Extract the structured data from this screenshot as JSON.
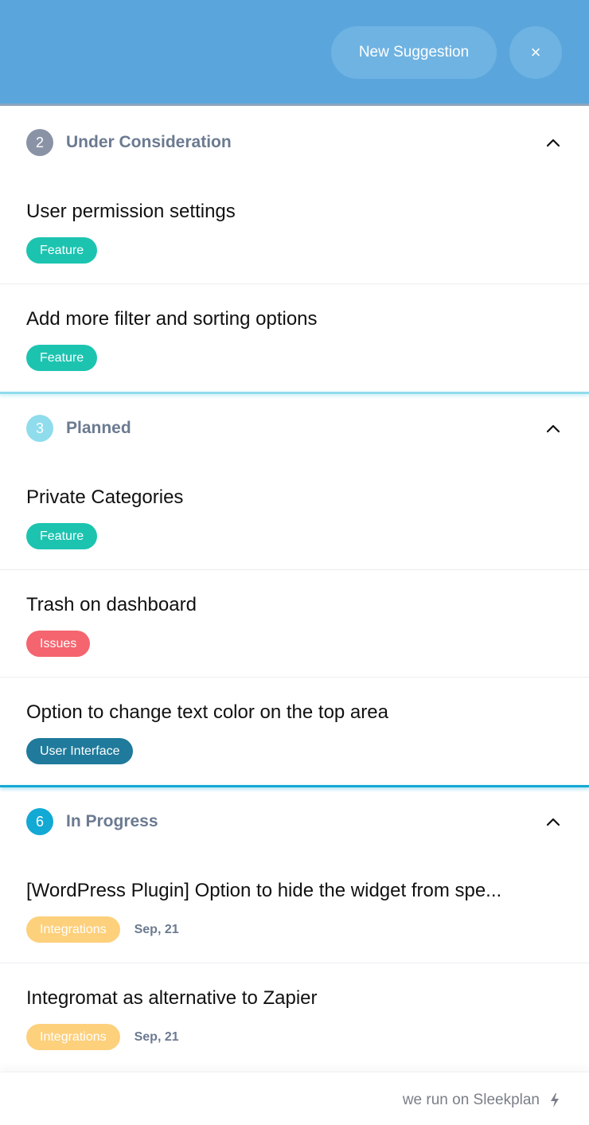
{
  "header": {
    "new_suggestion_label": "New Suggestion",
    "close_label": "×"
  },
  "sections": [
    {
      "count": "2",
      "title": "Under Consideration",
      "badge_color": "#8a93a6",
      "items": [
        {
          "title": "User permission settings",
          "tag": "Feature"
        },
        {
          "title": "Add more filter and sorting options",
          "tag": "Feature"
        }
      ]
    },
    {
      "count": "3",
      "title": "Planned",
      "badge_color": "#8fdcec",
      "items": [
        {
          "title": "Private Categories",
          "tag": "Feature"
        },
        {
          "title": "Trash on dashboard",
          "tag": "Issues"
        },
        {
          "title": "Option to change text color on the top area",
          "tag": "User Interface"
        }
      ]
    },
    {
      "count": "6",
      "title": "In Progress",
      "badge_color": "#12a9d4",
      "items": [
        {
          "title": "[WordPress Plugin] Option to hide the widget from spe...",
          "tag": "Integrations",
          "date": "Sep, 21"
        },
        {
          "title": "Integromat as alternative to Zapier",
          "tag": "Integrations",
          "date": "Sep, 21"
        }
      ]
    }
  ],
  "footer": {
    "text": "we run on Sleekplan",
    "icon": "bolt-icon"
  },
  "colors": {
    "header": "#5aa6dc",
    "feature": "#1cc4b0",
    "issues": "#f4656f",
    "user_interface": "#1f7a9b",
    "integrations": "#fdd07c"
  }
}
